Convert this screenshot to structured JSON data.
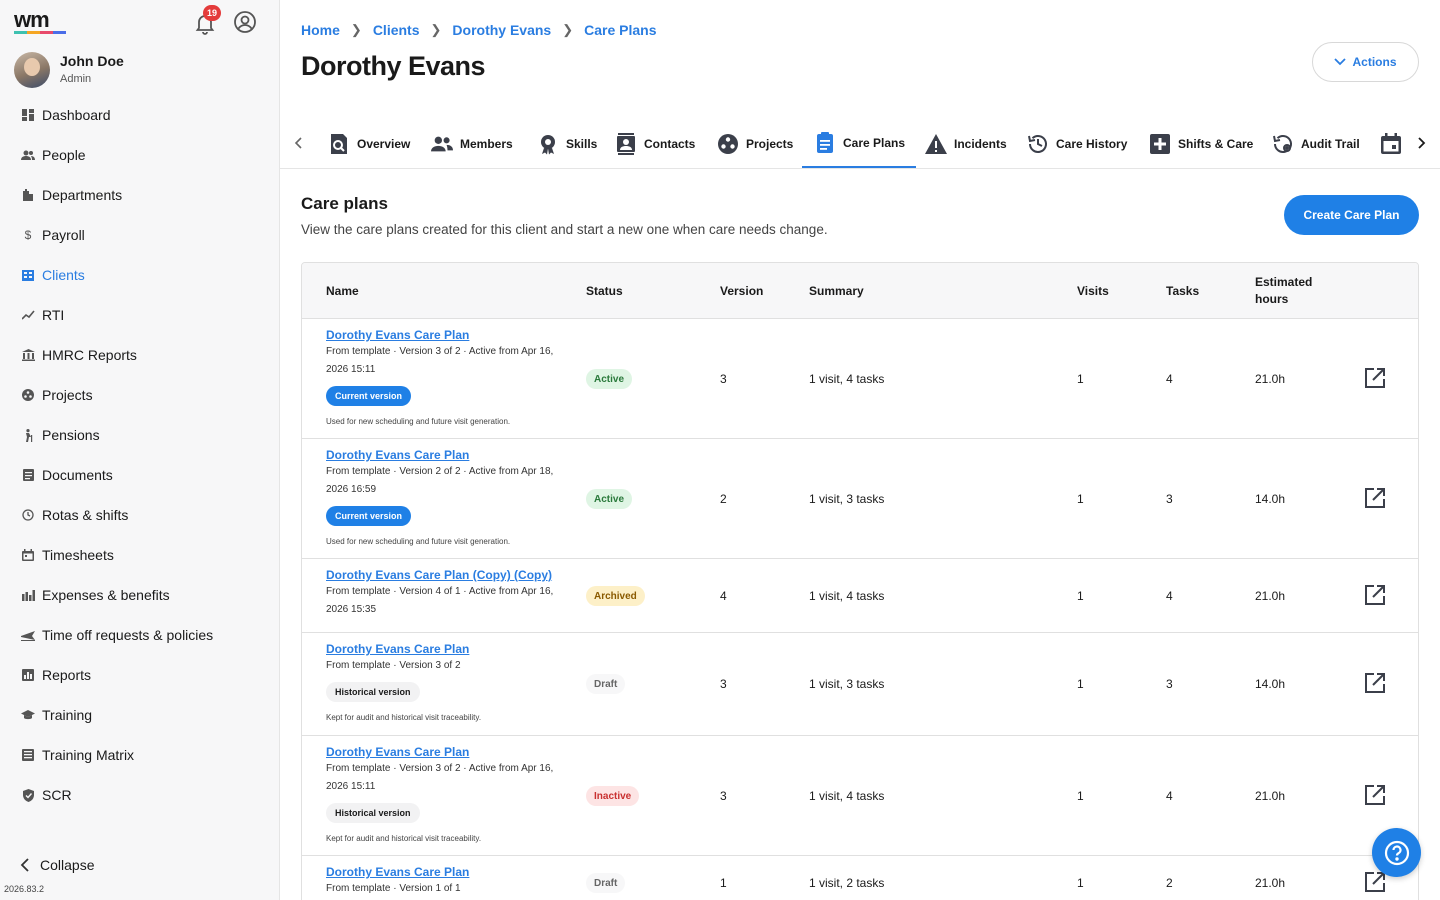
{
  "sidebar": {
    "notifications_count": "19",
    "user": {
      "name": "John Doe",
      "role": "Admin"
    },
    "items": [
      {
        "label": "Dashboard",
        "icon": "dashboard-icon"
      },
      {
        "label": "People",
        "icon": "people-icon"
      },
      {
        "label": "Departments",
        "icon": "departments-icon"
      },
      {
        "label": "Payroll",
        "icon": "payroll-icon"
      },
      {
        "label": "Clients",
        "icon": "clients-icon",
        "active": true
      },
      {
        "label": "RTI",
        "icon": "rti-icon"
      },
      {
        "label": "HMRC Reports",
        "icon": "hmrc-icon"
      },
      {
        "label": "Projects",
        "icon": "projects-icon"
      },
      {
        "label": "Pensions",
        "icon": "pensions-icon"
      },
      {
        "label": "Documents",
        "icon": "documents-icon"
      },
      {
        "label": "Rotas & shifts",
        "icon": "rotas-icon"
      },
      {
        "label": "Timesheets",
        "icon": "timesheets-icon"
      },
      {
        "label": "Expenses & benefits",
        "icon": "expenses-icon"
      },
      {
        "label": "Time off requests & policies",
        "icon": "time-off-icon"
      },
      {
        "label": "Reports",
        "icon": "reports-icon"
      },
      {
        "label": "Training",
        "icon": "training-icon"
      },
      {
        "label": "Training Matrix",
        "icon": "training-matrix-icon"
      },
      {
        "label": "SCR",
        "icon": "scr-icon"
      }
    ],
    "collapse_label": "Collapse",
    "version": "2026.83.2"
  },
  "breadcrumb": [
    "Home",
    "Clients",
    "Dorothy Evans",
    "Care Plans"
  ],
  "page_title": "Dorothy Evans",
  "actions_label": "Actions",
  "tabs": [
    {
      "label": "Overview",
      "icon": "overview-icon"
    },
    {
      "label": "Members",
      "icon": "members-icon"
    },
    {
      "label": "Skills",
      "icon": "skills-icon"
    },
    {
      "label": "Contacts",
      "icon": "contacts-icon"
    },
    {
      "label": "Projects",
      "icon": "projects-icon"
    },
    {
      "label": "Care Plans",
      "icon": "care-plans-icon",
      "active": true
    },
    {
      "label": "Incidents",
      "icon": "incidents-icon"
    },
    {
      "label": "Care History",
      "icon": "care-history-icon"
    },
    {
      "label": "Shifts & Care",
      "icon": "shifts-care-icon"
    },
    {
      "label": "Audit Trail",
      "icon": "audit-trail-icon"
    }
  ],
  "section": {
    "title": "Care plans",
    "description": "View the care plans created for this client and start a new one when care needs change.",
    "create_label": "Create Care Plan"
  },
  "table": {
    "headers": [
      "Name",
      "Status",
      "Version",
      "Summary",
      "Visits",
      "Tasks",
      "Estimated hours"
    ],
    "rows": [
      {
        "name": "Dorothy Evans Care Plan",
        "meta": "From template · Version 3 of 2 · Active from Apr 16, 2026 15:11",
        "badge": "Current version",
        "badge_type": "current",
        "note": "Used for new scheduling and future visit generation.",
        "status": "Active",
        "status_type": "active",
        "version": "3",
        "summary": "1 visit, 4 tasks",
        "visits": "1",
        "tasks": "4",
        "hours": "21.0h"
      },
      {
        "name": "Dorothy Evans Care Plan",
        "meta": "From template · Version 2 of 2 · Active from Apr 18, 2026 16:59",
        "badge": "Current version",
        "badge_type": "current",
        "note": "Used for new scheduling and future visit generation.",
        "status": "Active",
        "status_type": "active",
        "version": "2",
        "summary": "1 visit, 3 tasks",
        "visits": "1",
        "tasks": "3",
        "hours": "14.0h"
      },
      {
        "name": "Dorothy Evans Care Plan (Copy) (Copy)",
        "meta": "From template · Version 4 of 1 · Active from Apr 16, 2026 15:35",
        "badge": "",
        "badge_type": "",
        "note": "",
        "status": "Archived",
        "status_type": "archived",
        "version": "4",
        "summary": "1 visit, 4 tasks",
        "visits": "1",
        "tasks": "4",
        "hours": "21.0h"
      },
      {
        "name": "Dorothy Evans Care Plan",
        "meta": "From template · Version 3 of 2",
        "badge": "Historical version",
        "badge_type": "historical",
        "note": "Kept for audit and historical visit traceability.",
        "status": "Draft",
        "status_type": "draft",
        "version": "3",
        "summary": "1 visit, 3 tasks",
        "visits": "1",
        "tasks": "3",
        "hours": "14.0h"
      },
      {
        "name": "Dorothy Evans Care Plan",
        "meta": "From template · Version 3 of 2 · Active from Apr 16, 2026 15:11",
        "badge": "Historical version",
        "badge_type": "historical",
        "note": "Kept for audit and historical visit traceability.",
        "status": "Inactive",
        "status_type": "inactive",
        "version": "3",
        "summary": "1 visit, 4 tasks",
        "visits": "1",
        "tasks": "4",
        "hours": "21.0h"
      },
      {
        "name": "Dorothy Evans Care Plan",
        "meta": "From template · Version 1 of 1",
        "badge": "",
        "badge_type": "",
        "note": "",
        "status": "Draft",
        "status_type": "draft",
        "version": "1",
        "summary": "1 visit, 2 tasks",
        "visits": "1",
        "tasks": "2",
        "hours": "21.0h"
      }
    ]
  },
  "colors": {
    "accent": "#2a7de1",
    "primary_button": "#1f80e6",
    "badge_red": "#e43b3b"
  }
}
